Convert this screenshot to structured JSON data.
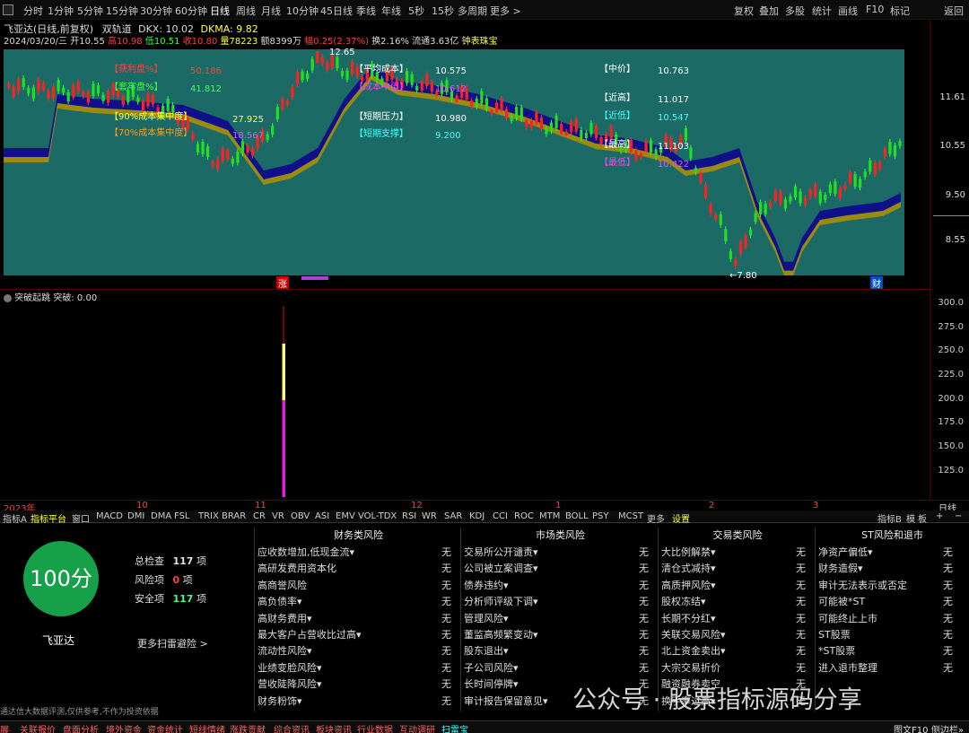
{
  "toolbar": {
    "periods": [
      "分时",
      "1分钟",
      "5分钟",
      "15分钟",
      "30分钟",
      "60分钟",
      "日线",
      "周线",
      "月线",
      "10分钟",
      "45日线",
      "季线",
      "年线",
      "5秒",
      "15秒",
      "多周期",
      "更多 >"
    ],
    "active_period": "日线",
    "right_buttons": [
      "复权",
      "叠加",
      "多股",
      "统计",
      "画线",
      "F10",
      "标记",
      "返回"
    ]
  },
  "stock": {
    "name_line": "飞亚达(日线,前复权)",
    "indicator": "双轨道",
    "dkx": "DKX: 10.02",
    "dkma": "DKMA: 9.82",
    "date": "2024/03/20/三",
    "open": "开10.55",
    "high": "高10.98",
    "low": "低10.51",
    "close": "收10.80",
    "volume": "量78223",
    "amount": "额8399万",
    "change": "幅0.25(2.37%)",
    "turnover": "换2.16%",
    "float": "流通3.63亿",
    "extra": "钟表珠宝"
  },
  "chart_annotations": {
    "profit_pct_label": "【获利盘%】",
    "profit_pct_value": "50.186",
    "locked_pct_label": "【套牢盘%】",
    "locked_pct_value": "41.812",
    "c90_label": "【90%成本集中度】",
    "c90_value": "27.925",
    "c70_label": "【70%成本集中度】",
    "c70_value": "18.567",
    "avg_cost_label": "【平均成本】",
    "avg_cost_value": "10.575",
    "mid_cost_label": "【成本中值】",
    "mid_cost_value": "10.612",
    "short_press_label": "【短期压力】",
    "short_press_value": "10.980",
    "short_support_label": "【短期支撑】",
    "short_support_value": "9.200",
    "mid_price_label": "【中价】",
    "mid_price_value": "10.763",
    "near_high_label": "【近高】",
    "near_high_value": "11.017",
    "near_low_label": "【近低】",
    "near_low_value": "10.547",
    "highest_label": "【最高】",
    "highest_value": "11.103",
    "lowest_label": "【最低】",
    "lowest_value": "10.422",
    "peak_mark": "12.65",
    "trough_mark": "←7.80",
    "marker_zhang": "涨",
    "marker_cai": "财"
  },
  "price_axis": [
    "11.61",
    "10.55",
    "9.50",
    "8.55"
  ],
  "sub_chart": {
    "label": "突破起跳",
    "value_text": "突破: 0.00",
    "axis": [
      "300.0",
      "275.0",
      "250.0",
      "225.0",
      "200.0",
      "175.0",
      "150.0",
      "125.0"
    ]
  },
  "date_axis": {
    "labels": [
      "2023年",
      "10",
      "11",
      "12",
      "1",
      "2",
      "3"
    ],
    "right": "日线"
  },
  "indicator_tabs": [
    "指标A",
    "指标平台",
    "窗口",
    "MACD",
    "DMI",
    "DMA",
    "FSL",
    "TRIX",
    "BRAR",
    "CR",
    "VR",
    "OBV",
    "ASI",
    "EMV",
    "VOL-TDX",
    "RSI",
    "WR",
    "SAR",
    "KDJ",
    "CCI",
    "ROC",
    "MTM",
    "BOLL",
    "PSY",
    "MCST",
    "更多",
    "设置"
  ],
  "indicator_tabs_right": [
    "指标B",
    "模",
    "板",
    "+",
    "−"
  ],
  "risk": {
    "score": "100分",
    "total_label": "总检查",
    "total_num": "117",
    "total_unit": "项",
    "risk_label": "风险项",
    "risk_num": "0",
    "risk_unit": "项",
    "safe_label": "安全项",
    "safe_num": "117",
    "safe_unit": "项",
    "company": "飞亚达",
    "more_link": "更多扫雷避险 >",
    "disclaimer": "通达信大数据评测,仅供参考,不作为投资依据",
    "columns": [
      {
        "title": "财务类风险",
        "items": [
          "应收数增加,低现金流▾",
          "高研发费用资本化",
          "高商誉风险",
          "高负债率▾",
          "高财务费用▾",
          "最大客户占营收比过高▾",
          "流动性风险▾",
          "业绩变脸风险▾",
          "营收陡降风险▾",
          "财务粉饰▾"
        ]
      },
      {
        "title": "市场类风险",
        "items": [
          "交易所公开谴责▾",
          "公司被立案调查▾",
          "债券违约▾",
          "分析师评级下调▾",
          "管理风险▾",
          "董监高频繁变动▾",
          "股东退出▾",
          "子公司风险▾",
          "长时间停牌▾",
          "审计报告保留意见▾"
        ]
      },
      {
        "title": "交易类风险",
        "items": [
          "大比例解禁▾",
          "清仓式减持▾",
          "高质押风险▾",
          "股权冻结▾",
          "长期不分红▾",
          "关联交易风险▾",
          "北上资金卖出▾",
          "大宗交易折价",
          "融资融券卖空",
          "换手率过高▾"
        ]
      },
      {
        "title": "ST风险和退市",
        "items": [
          "净资产偏低▾",
          "财务造假▾",
          "审计无法表示或否定",
          "可能被*ST",
          "可能终止上市",
          "ST股票",
          "*ST股票",
          "进入退市整理"
        ]
      }
    ],
    "none_text": "无"
  },
  "bottom_tabs": [
    "展",
    "关联报价",
    "盘面分析",
    "境外资金",
    "资金统计",
    "短线情绪",
    "涨跌贡献",
    "综合资讯",
    "板块资讯",
    "行业数据",
    "互动调研",
    "扫雷宝"
  ],
  "bottom_right": "图文F10",
  "bottom_right2": "侧边栏»",
  "watermark": "公众号 · 股票指标源码分享"
}
